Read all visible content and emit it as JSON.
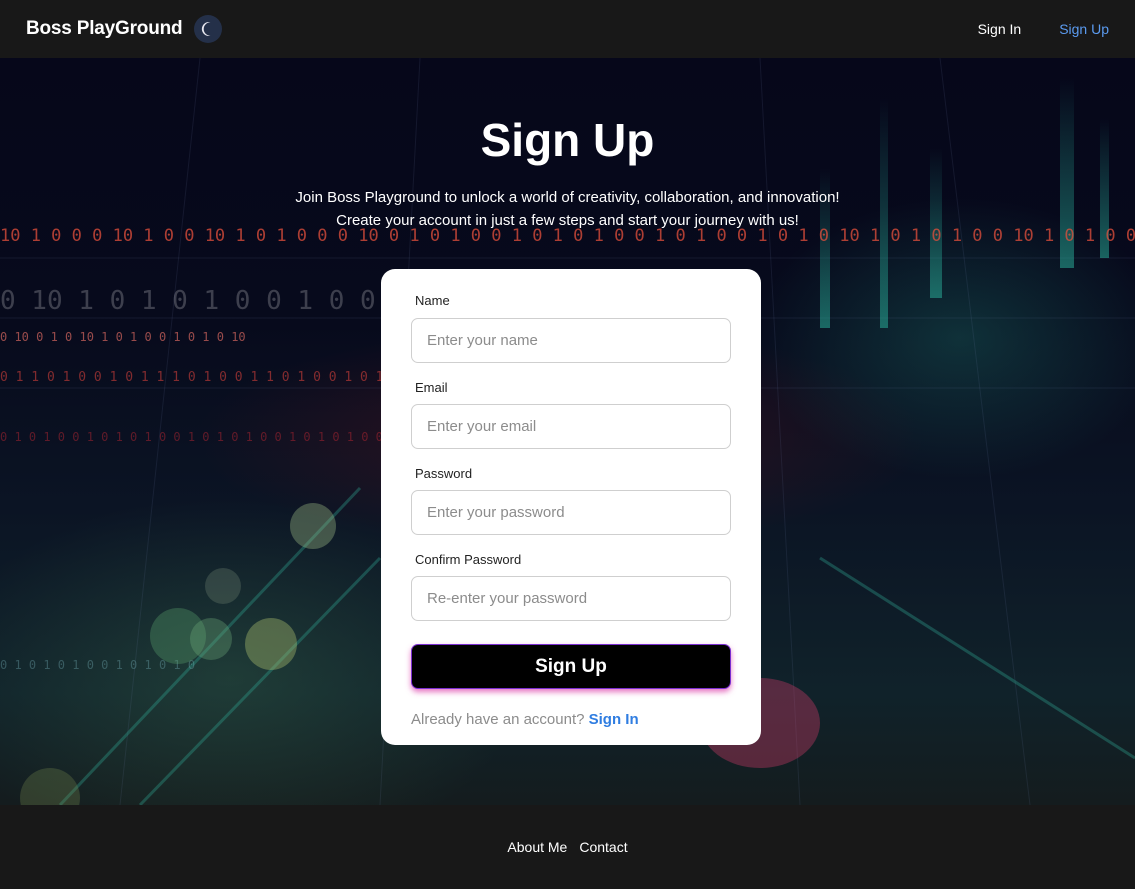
{
  "navbar": {
    "brand": "Boss PlayGround",
    "theme_toggle_icon": "moon-icon",
    "links": [
      {
        "label": "Sign In",
        "active": false
      },
      {
        "label": "Sign Up",
        "active": true
      }
    ],
    "active_color": "#5b9bf0"
  },
  "page": {
    "title": "Sign Up",
    "intro_line_1": "Join Boss Playground to unlock a world of creativity, collaboration, and innovation!",
    "intro_line_2": "Create your account in just a few steps and start your journey with us!"
  },
  "form": {
    "fields": [
      {
        "label": "Name",
        "placeholder": "Enter your name",
        "value": ""
      },
      {
        "label": "Email",
        "placeholder": "Enter your email",
        "value": ""
      },
      {
        "label": "Password",
        "placeholder": "Enter your password",
        "value": ""
      },
      {
        "label": "Confirm Password",
        "placeholder": "Re-enter your password",
        "value": ""
      }
    ],
    "submit_label": "Sign Up",
    "signin_prompt": "Already have an account?",
    "signin_link": "Sign In"
  },
  "footer": {
    "links": [
      "About Me",
      "Contact"
    ]
  },
  "colors": {
    "navbar_bg": "#181818",
    "card_bg": "#ffffff",
    "button_bg": "#000000",
    "button_glow": "#dc3caa",
    "link_blue": "#2f7de1"
  }
}
